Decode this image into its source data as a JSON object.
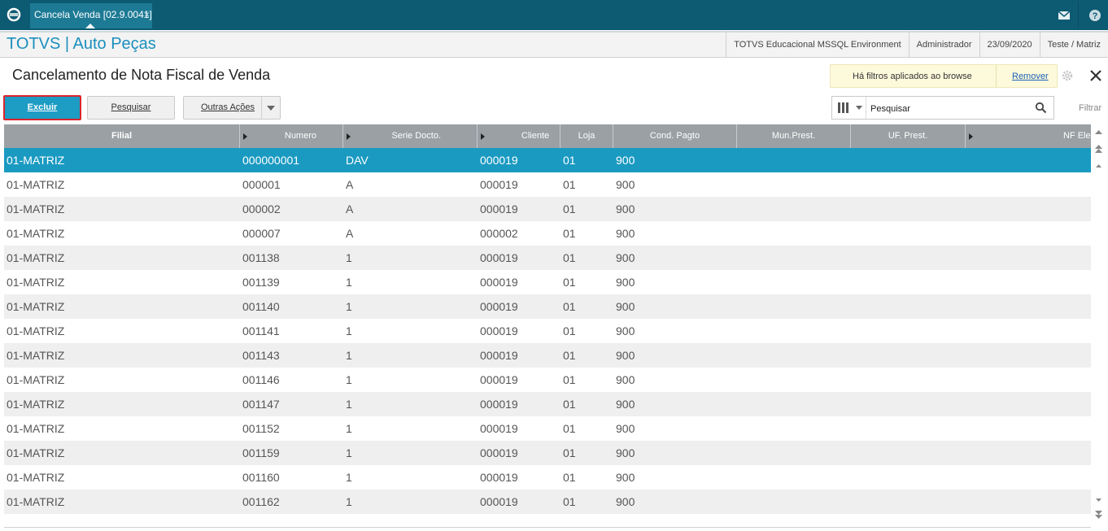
{
  "topbar": {
    "tab_label": "Cancela Venda [02.9.0041]",
    "tab_close": "×",
    "icons": [
      "totvs-logo-icon",
      "mail-icon",
      "help-icon"
    ]
  },
  "header": {
    "app_title": "TOTVS | Auto Peças",
    "environment": "TOTVS Educacional MSSQL Environment",
    "user": "Administrador",
    "date": "23/09/2020",
    "branch": "Teste / Matriz"
  },
  "page": {
    "title": "Cancelamento de Nota Fiscal de Venda",
    "filter_notice": "Há filtros aplicados ao browse",
    "remove_label": "Remover"
  },
  "toolbar": {
    "excluir": "Excluir",
    "pesquisar": "Pesquisar",
    "outras_acoes": "Outras Ações",
    "search_placeholder": "Pesquisar",
    "filtrar": "Filtrar"
  },
  "grid": {
    "columns": [
      "Filial",
      "Numero",
      "Serie Docto.",
      "Cliente",
      "Loja",
      "Cond. Pagto",
      "Mun.Prest.",
      "UF. Prest.",
      "NF Elet"
    ],
    "rows": [
      [
        "01-MATRIZ",
        "000000001",
        "DAV",
        "000019",
        "01",
        "900"
      ],
      [
        "01-MATRIZ",
        "000001",
        "A",
        "000019",
        "01",
        "900"
      ],
      [
        "01-MATRIZ",
        "000002",
        "A",
        "000019",
        "01",
        "900"
      ],
      [
        "01-MATRIZ",
        "000007",
        "A",
        "000002",
        "01",
        "900"
      ],
      [
        "01-MATRIZ",
        "001138",
        "1",
        "000019",
        "01",
        "900"
      ],
      [
        "01-MATRIZ",
        "001139",
        "1",
        "000019",
        "01",
        "900"
      ],
      [
        "01-MATRIZ",
        "001140",
        "1",
        "000019",
        "01",
        "900"
      ],
      [
        "01-MATRIZ",
        "001141",
        "1",
        "000019",
        "01",
        "900"
      ],
      [
        "01-MATRIZ",
        "001143",
        "1",
        "000019",
        "01",
        "900"
      ],
      [
        "01-MATRIZ",
        "001146",
        "1",
        "000019",
        "01",
        "900"
      ],
      [
        "01-MATRIZ",
        "001147",
        "1",
        "000019",
        "01",
        "900"
      ],
      [
        "01-MATRIZ",
        "001152",
        "1",
        "000019",
        "01",
        "900"
      ],
      [
        "01-MATRIZ",
        "001159",
        "1",
        "000019",
        "01",
        "900"
      ],
      [
        "01-MATRIZ",
        "001160",
        "1",
        "000019",
        "01",
        "900"
      ],
      [
        "01-MATRIZ",
        "001162",
        "1",
        "000019",
        "01",
        "900"
      ]
    ],
    "selected_row": 0
  },
  "colors": {
    "topbar": "#0d5b73",
    "accent": "#1a9ac1",
    "header_grid": "#9aa0a4",
    "highlight_border": "#d9262b"
  }
}
